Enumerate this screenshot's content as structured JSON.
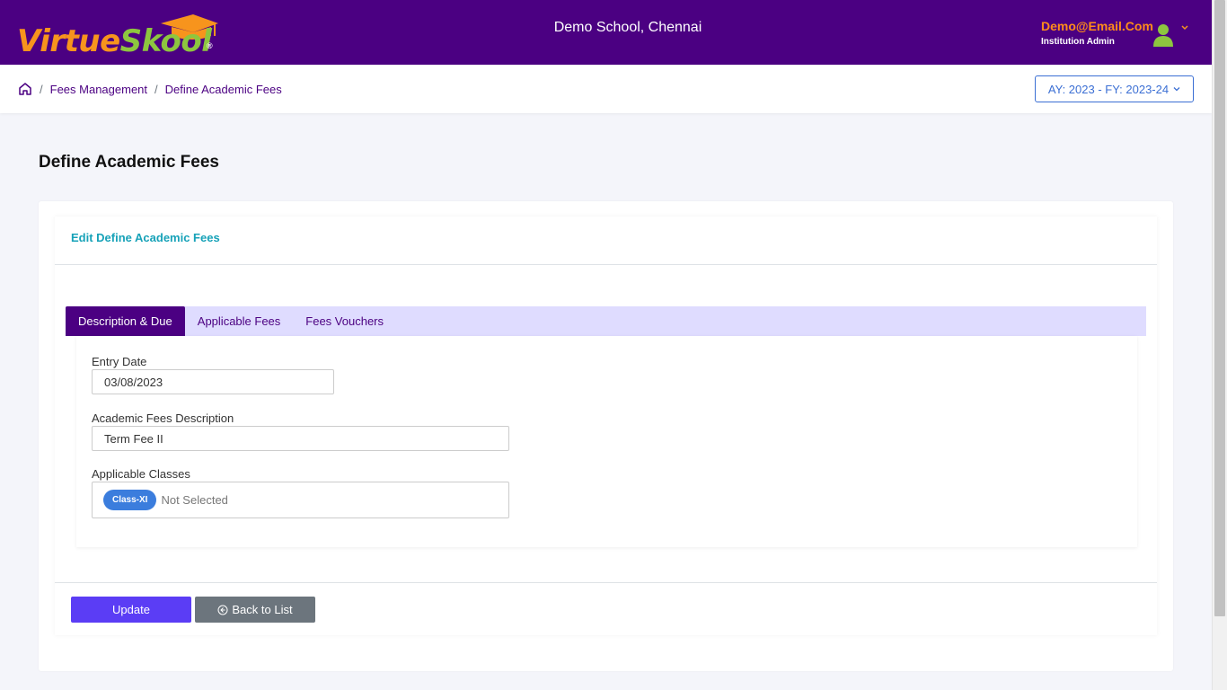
{
  "header": {
    "logo_part1": "Virtue",
    "logo_part2": "Sk",
    "logo_part3": "ool",
    "logo_mark": "®",
    "school_name": "Demo School, Chennai",
    "user_email": "Demo@Email.Com",
    "user_role": "Institution Admin"
  },
  "breadcrumb": {
    "items": [
      "Fees Management",
      "Define Academic Fees"
    ],
    "separator": "/"
  },
  "year_selector": {
    "label": "AY: 2023 - FY: 2023-24"
  },
  "page": {
    "title": "Define Academic Fees"
  },
  "card": {
    "title": "Edit Define Academic Fees"
  },
  "tabs": [
    {
      "label": "Description & Due",
      "active": true
    },
    {
      "label": "Applicable Fees",
      "active": false
    },
    {
      "label": "Fees Vouchers",
      "active": false
    }
  ],
  "form": {
    "entry_date": {
      "label": "Entry Date",
      "value": "03/08/2023"
    },
    "description": {
      "label": "Academic Fees Description",
      "value": "Term Fee II"
    },
    "classes": {
      "label": "Applicable Classes",
      "selected": [
        "Class-XI"
      ],
      "placeholder": "Not Selected"
    }
  },
  "buttons": {
    "update": "Update",
    "back": "Back to List"
  },
  "colors": {
    "brand_purple": "#4b0082",
    "accent_orange": "#f7941d",
    "accent_green": "#8dc63f",
    "primary_button": "#5b3df5",
    "secondary_button": "#6c757d",
    "tab_strip": "#dfdcff",
    "card_title": "#17a2b8"
  }
}
